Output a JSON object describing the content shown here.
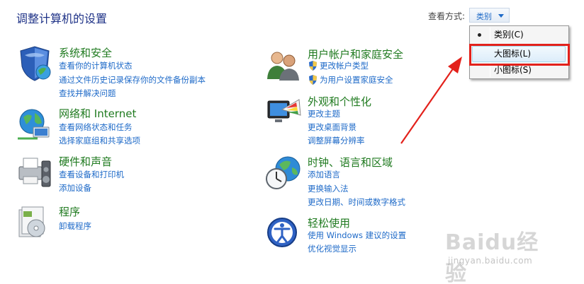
{
  "page": {
    "title": "调整计算机的设置"
  },
  "view_by": {
    "label": "查看方式:",
    "selected": "类别",
    "options": [
      {
        "label": "类别(C)",
        "checked": true
      },
      {
        "label": "大图标(L)",
        "highlighted": true
      },
      {
        "label": "小图标(S)"
      }
    ]
  },
  "categories": {
    "system_security": {
      "title": "系统和安全",
      "icon": "shield-globe-icon",
      "links": [
        "查看你的计算机状态",
        "通过文件历史记录保存你的文件备份副本",
        "查找并解决问题"
      ]
    },
    "network": {
      "title": "网络和 Internet",
      "icon": "network-globe-icon",
      "links": [
        "查看网络状态和任务",
        "选择家庭组和共享选项"
      ]
    },
    "hardware": {
      "title": "硬件和声音",
      "icon": "printer-speaker-icon",
      "links": [
        "查看设备和打印机",
        "添加设备"
      ]
    },
    "programs": {
      "title": "程序",
      "icon": "programs-disc-icon",
      "links": [
        "卸载程序"
      ]
    },
    "user_accounts": {
      "title": "用户帐户和家庭安全",
      "icon": "users-icon",
      "links": [
        "更改帐户类型",
        "为用户设置家庭安全"
      ]
    },
    "appearance": {
      "title": "外观和个性化",
      "icon": "monitor-palette-icon",
      "links": [
        "更改主题",
        "更改桌面背景",
        "调整屏幕分辨率"
      ]
    },
    "clock_region": {
      "title": "时钟、语言和区域",
      "icon": "clock-globe-icon",
      "links": [
        "添加语言",
        "更换输入法",
        "更改日期、时间或数字格式"
      ]
    },
    "ease_of_access": {
      "title": "轻松使用",
      "icon": "accessibility-icon",
      "links": [
        "使用 Windows 建议的设置",
        "优化视觉显示"
      ]
    }
  },
  "watermark": {
    "brand": "Baidu经验",
    "url": "jingyan.baidu.com"
  },
  "colors": {
    "link": "#1e6ac8",
    "category_title": "#1f7a1f",
    "annotation": "#e3211b"
  }
}
